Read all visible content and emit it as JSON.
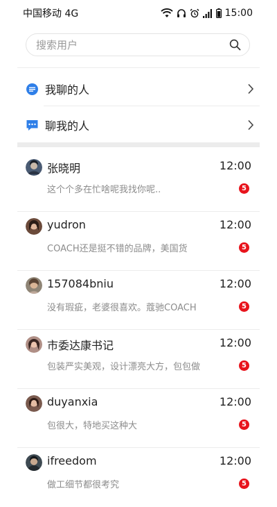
{
  "status_bar": {
    "carrier": "中国移动 4G",
    "time": "15:00",
    "icons": [
      "wifi-icon",
      "headphones-icon",
      "alarm-icon",
      "signal-icon",
      "battery-icon"
    ]
  },
  "search": {
    "placeholder": "搜索用户",
    "value": ""
  },
  "nav": [
    {
      "label": "我聊的人",
      "icon": "chat-bubble-round-icon",
      "color": "#2f7fe8"
    },
    {
      "label": "聊我的人",
      "icon": "chat-bubble-square-icon",
      "color": "#2f7fe8"
    }
  ],
  "chats": [
    {
      "name": "张晓明",
      "time": "12:00",
      "preview": "这个个多在忙啥呢我找你呢..",
      "badge": "5"
    },
    {
      "name": "yudron",
      "time": "12:00",
      "preview": "COACH还是挺不错的品牌，美国货",
      "badge": "5"
    },
    {
      "name": "157084bniu",
      "time": "12:00",
      "preview": "没有瑕疵，老婆很喜欢。蔻驰COACH",
      "badge": "5"
    },
    {
      "name": "市委达康书记",
      "time": "12:00",
      "preview": "包装严实美观，设计漂亮大方，包包做",
      "badge": "5"
    },
    {
      "name": "duyanxia",
      "time": "12:00",
      "preview": "包很大，特地买这种大",
      "badge": "5"
    },
    {
      "name": "ifreedom",
      "time": "12:00",
      "preview": "做工细节都很考究",
      "badge": "5"
    }
  ],
  "colors": {
    "badge": "#e8141d",
    "accent": "#2f7fe8",
    "divider": "#ececec"
  }
}
